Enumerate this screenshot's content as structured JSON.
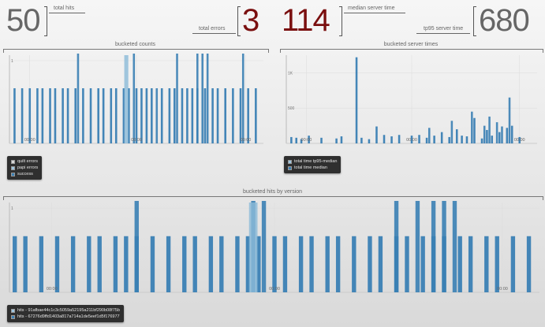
{
  "kpis": {
    "total_hits": {
      "value": "50",
      "label": "total hits"
    },
    "total_errors": {
      "value": "3",
      "label": "total errors"
    },
    "median_server_time": {
      "value": "114",
      "label": "median server time"
    },
    "tp95_server_time": {
      "value": "680",
      "label": "tp95 server time"
    }
  },
  "colors": {
    "bar": "#3a7fb4",
    "bar_light": "#8bbad8",
    "number_red": "#7a0f0f",
    "number_gray": "#666666"
  },
  "sections": {
    "bucketed_counts": "bucketed counts",
    "bucketed_server_times": "bucketed server times",
    "bucketed_hits_by_version": "bucketed hits by version"
  },
  "chart_data": [
    {
      "id": "counts",
      "type": "bar",
      "title": "bucketed counts",
      "y_ticks": [
        "1"
      ],
      "x_ticks": [
        "00:00",
        "00:00",
        "00:00"
      ],
      "ylim": [
        0,
        1.6
      ],
      "grid": true,
      "legend": {
        "placement": "bottom-left",
        "entries": [
          "quilt errors",
          "papi errors",
          "success"
        ]
      },
      "series": [
        {
          "name": "success",
          "x": [
            0.02,
            0.05,
            0.08,
            0.11,
            0.13,
            0.16,
            0.18,
            0.21,
            0.23,
            0.26,
            0.29,
            0.32,
            0.35,
            0.37,
            0.4,
            0.42,
            0.45,
            0.47,
            0.5,
            0.52,
            0.54,
            0.56,
            0.6,
            0.63,
            0.65,
            0.68,
            0.7,
            0.72,
            0.74,
            0.77,
            0.8,
            0.82,
            0.85,
            0.88,
            0.91,
            0.94,
            0.97
          ],
          "values": [
            1,
            1,
            1,
            1,
            1,
            1,
            1,
            1,
            1,
            1,
            1,
            1,
            1,
            1,
            1,
            1,
            1,
            1,
            1,
            1,
            1,
            1,
            1,
            1,
            1,
            1,
            1,
            1,
            1,
            1,
            1,
            1,
            1,
            1,
            1,
            1,
            1
          ]
        },
        {
          "name": "",
          "x": [
            0.27,
            0.49,
            0.58,
            0.66,
            0.74,
            0.76,
            0.78,
            0.92
          ],
          "values": [
            2,
            2,
            1,
            2,
            2,
            2,
            2,
            2
          ]
        }
      ]
    },
    {
      "id": "server_times",
      "type": "bar",
      "title": "bucketed server times",
      "y_ticks": [
        "1K",
        "500"
      ],
      "x_ticks": [
        "00:00",
        "00:00",
        "00:00"
      ],
      "ylim": [
        0,
        1250
      ],
      "grid": true,
      "legend": {
        "placement": "bottom-left",
        "entries": [
          "total time tp95-median",
          "total time median"
        ]
      },
      "series": [
        {
          "name": "total time median",
          "x": [
            0.02,
            0.04,
            0.06,
            0.09,
            0.14,
            0.2,
            0.22,
            0.28,
            0.3,
            0.33,
            0.36,
            0.39,
            0.42,
            0.45,
            0.5,
            0.53,
            0.56,
            0.59,
            0.62,
            0.65,
            0.68,
            0.7,
            0.72,
            0.75,
            0.78,
            0.8,
            0.82,
            0.85,
            0.88,
            0.9,
            0.93
          ],
          "values": [
            90,
            80,
            60,
            110,
            80,
            70,
            100,
            1220,
            80,
            60,
            240,
            120,
            100,
            120,
            110,
            120,
            80,
            110,
            160,
            90,
            200,
            110,
            100,
            360,
            70,
            190,
            110,
            160,
            220,
            250,
            90
          ]
        },
        {
          "name": "total time tp95-median",
          "x": [
            0.57,
            0.66,
            0.74,
            0.79,
            0.81,
            0.84,
            0.86,
            0.89
          ],
          "values": [
            220,
            320,
            450,
            250,
            380,
            300,
            240,
            650
          ]
        }
      ]
    },
    {
      "id": "versions",
      "type": "bar",
      "title": "bucketed hits by version",
      "y_ticks": [
        "1"
      ],
      "x_ticks": [
        "00:00",
        "00:00",
        "00:00"
      ],
      "ylim": [
        0,
        1.6
      ],
      "grid": true,
      "legend": {
        "placement": "bottom-left",
        "entries": [
          "hits - 91afbae44c1c3c5059a52195a211bf290b08f75b",
          "hits - 67276d9ffd1403a817a714a1de5eef1d5f176977"
        ]
      },
      "series": [
        {
          "name": "hits - 91afbae44c1c3c5059a52195a211bf290b08f75b",
          "x": [
            0.01,
            0.03,
            0.06,
            0.09,
            0.12,
            0.15,
            0.17,
            0.2,
            0.22,
            0.24,
            0.27,
            0.3,
            0.33,
            0.35,
            0.38,
            0.4,
            0.43,
            0.45,
            0.47,
            0.5,
            0.52,
            0.55,
            0.57,
            0.6,
            0.62,
            0.65,
            0.68,
            0.7,
            0.73,
            0.75,
            0.78,
            0.8,
            0.82,
            0.85,
            0.87,
            0.9,
            0.92,
            0.95,
            0.98
          ],
          "values": [
            1,
            1,
            1,
            1,
            1,
            1,
            1,
            1,
            1,
            1,
            1,
            1,
            1,
            1,
            1,
            1,
            1,
            1,
            1,
            1,
            1,
            1,
            1,
            1,
            1,
            1,
            1,
            1,
            1,
            1,
            1,
            1,
            1,
            1,
            1,
            1,
            1,
            1,
            1
          ]
        },
        {
          "name": "",
          "x": [
            0.24,
            0.46,
            0.48,
            0.73,
            0.77,
            0.8,
            0.82,
            0.84
          ],
          "values": [
            2,
            2,
            2,
            2,
            2,
            2,
            2,
            2
          ]
        }
      ]
    }
  ]
}
